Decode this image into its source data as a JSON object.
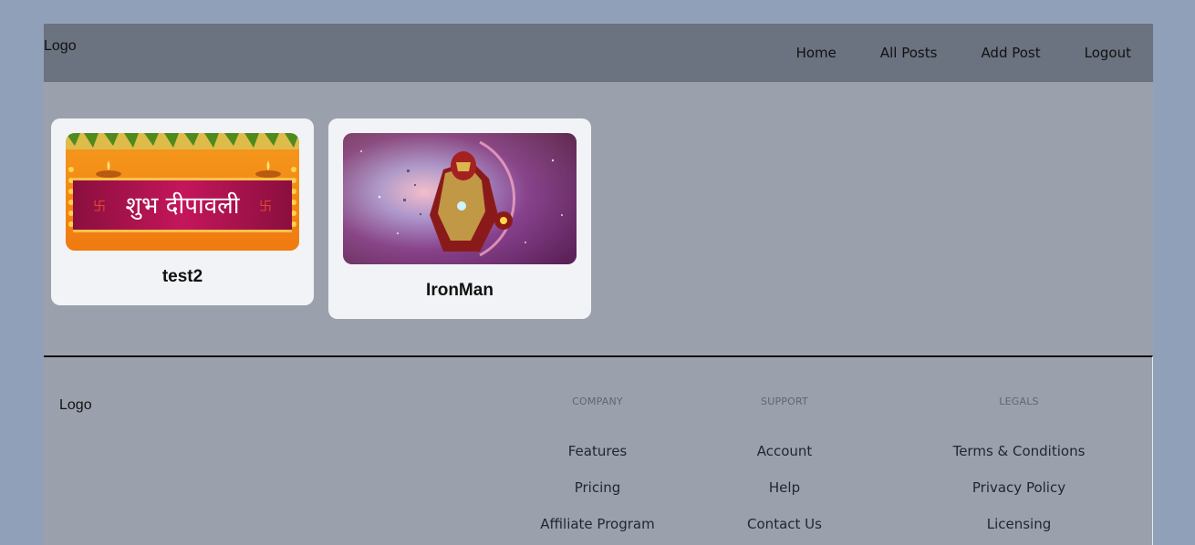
{
  "navbar": {
    "logo": "Logo",
    "links": [
      "Home",
      "All Posts",
      "Add Post",
      "Logout"
    ]
  },
  "posts": [
    {
      "title": "test2",
      "image": "Diwali greeting banner"
    },
    {
      "title": "IronMan",
      "image": "Iron Man artwork"
    }
  ],
  "diwali_text": "शुभ दीपावली",
  "footer": {
    "logo": "Logo",
    "columns": [
      {
        "heading": "COMPANY",
        "links": [
          "Features",
          "Pricing",
          "Affiliate Program"
        ]
      },
      {
        "heading": "SUPPORT",
        "links": [
          "Account",
          "Help",
          "Contact Us"
        ]
      },
      {
        "heading": "LEGALS",
        "links": [
          "Terms & Conditions",
          "Privacy Policy",
          "Licensing"
        ]
      }
    ]
  },
  "colors": {
    "page_bg": "#8fa0b8",
    "frame_bg": "#9ba1ac",
    "navbar_bg": "#6b7280",
    "card_bg": "#f2f3f6"
  }
}
